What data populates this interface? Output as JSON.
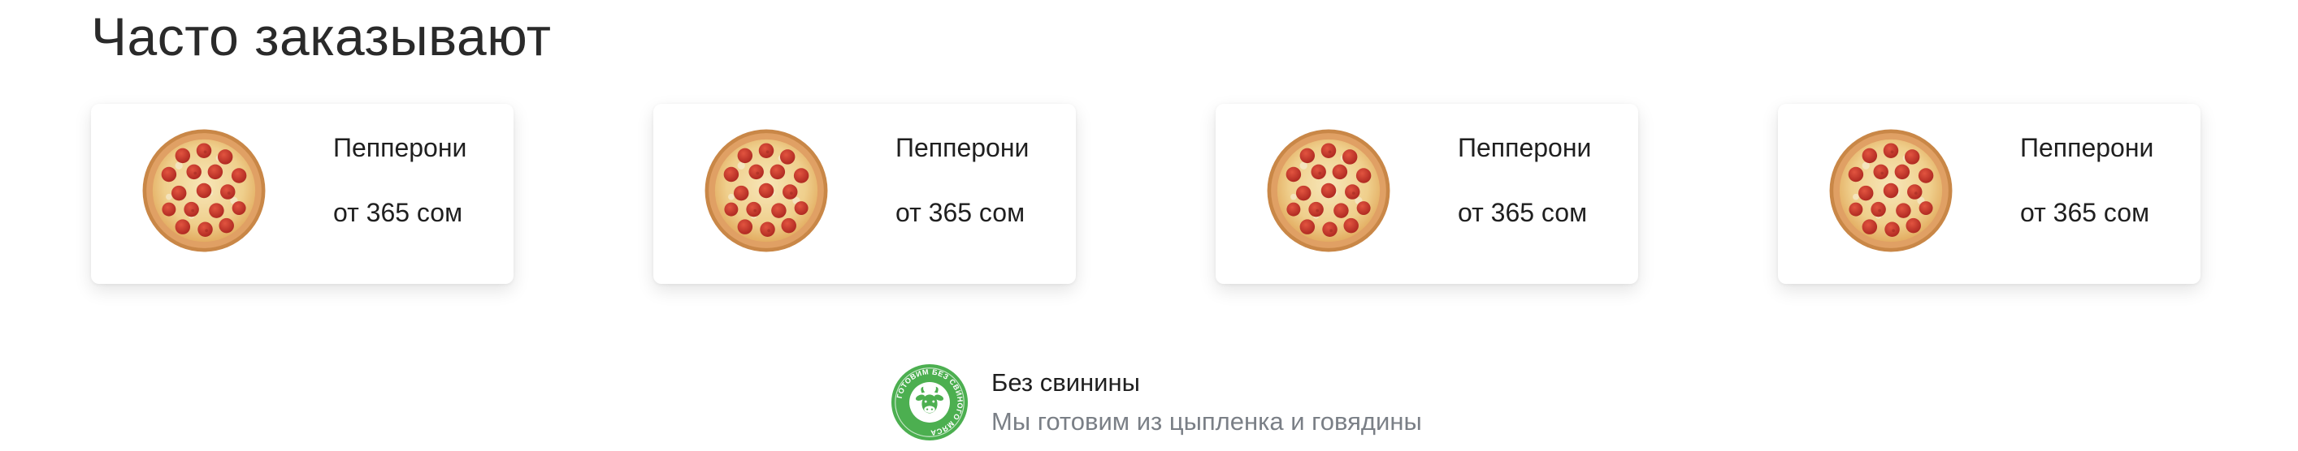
{
  "section": {
    "title": "Часто заказывают"
  },
  "products": [
    {
      "name": "Пепперони",
      "price": "от 365 сом",
      "image_icon": "pepperoni-pizza-image"
    },
    {
      "name": "Пепперони",
      "price": "от 365 сом",
      "image_icon": "pepperoni-pizza-image"
    },
    {
      "name": "Пепперони",
      "price": "от 365 сом",
      "image_icon": "pepperoni-pizza-image"
    },
    {
      "name": "Пепперони",
      "price": "от 365 сом",
      "image_icon": "pepperoni-pizza-image"
    }
  ],
  "promo": {
    "badge_icon": "no-pork-badge-icon",
    "badge_text": "ГОТОВИМ БЕЗ СВИНОГО МЯСА",
    "title": "Без свинины",
    "subtitle": "Мы готовим из цыпленка и говядины"
  },
  "colors": {
    "badge_green": "#4caf50",
    "muted_text": "#7a7f86",
    "title_text": "#2a2a2a",
    "pepperoni": "#c8372d",
    "crust": "#e0a064",
    "cheese": "#f2dfae"
  }
}
